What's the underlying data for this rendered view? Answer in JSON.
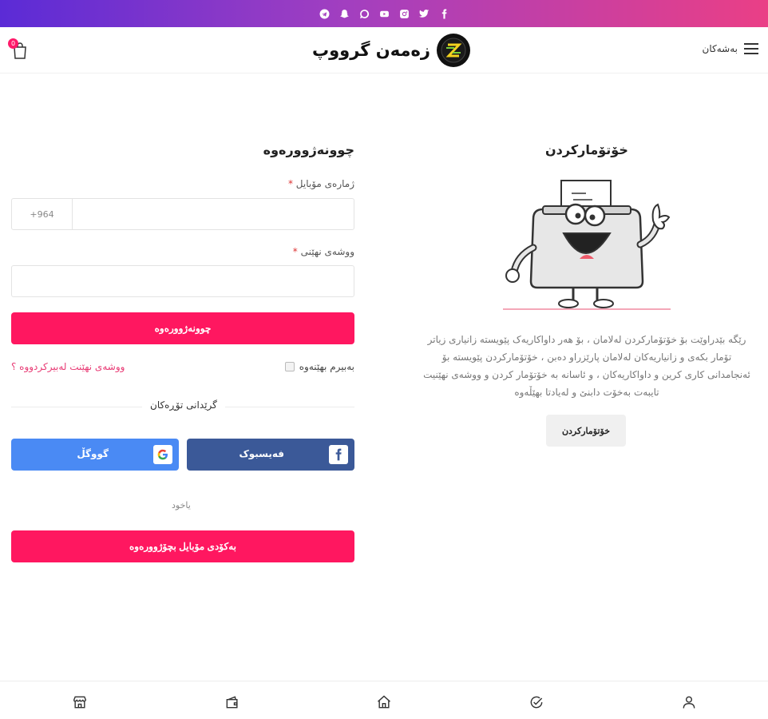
{
  "colors": {
    "accent": "#ff1760",
    "top_bar_start": "#5b2bd6",
    "top_bar_end": "#ea3f86",
    "facebook": "#3b5998",
    "google": "#4a8af4",
    "forgot_link": "#e83a74"
  },
  "top_bar": {
    "social_icons": [
      "telegram-icon",
      "snapchat-icon",
      "whatsapp-icon",
      "youtube-icon",
      "instagram-icon",
      "twitter-icon",
      "facebook-icon"
    ]
  },
  "header": {
    "menu_label": "بەشەکان",
    "logo_text": "زەمەن گرووپ",
    "cart_count": "0"
  },
  "login": {
    "title": "چوونەژوورەوە",
    "phone_label": "ژمارەی مۆبایل",
    "required_mark": "*",
    "phone_prefix": "+964",
    "phone_value": "",
    "password_label": "ووشەی نهێنی",
    "password_value": "",
    "submit_label": "چوونەژوورەوە",
    "remember_label": "بەبیرم بهێنەوە",
    "forgot_label": "ووشەی نهێنت لەبیرکردووە ؟",
    "divider_label": "گرێدانی تۆڕەکان",
    "facebook_label": "فەیسبوک",
    "google_label": "گووگڵ",
    "or_label": "یاخود",
    "mobile_code_label": "بەکۆدی مۆبایل بچۆژوورەوە"
  },
  "register": {
    "title": "خۆتۆمارکردن",
    "description_lines": [
      "رێگە بێدراوێت بۆ خۆتۆمارکردن لەلامان ، بۆ هەر داواکاریەک پێویستە زانیاری زیاتر",
      "تۆمار بکەی و زانیاریەکان لەلامان پارێزراو دەبن ، خۆتۆمارکردن پێویستە بۆ",
      "ئەنجامدانی کاری کرین و داواکاریەکان ، و ئاسانە بە خۆتۆمار کردن و ووشەی نهێنیت",
      "تایبەت بەخۆت دابنێ و لەیادتا بهێڵەوە"
    ],
    "button_label": "خۆتۆمارکردن"
  },
  "bottom_nav": {
    "items": [
      "store-icon",
      "wallet-icon",
      "home-icon",
      "check-circle-icon",
      "user-icon"
    ]
  }
}
